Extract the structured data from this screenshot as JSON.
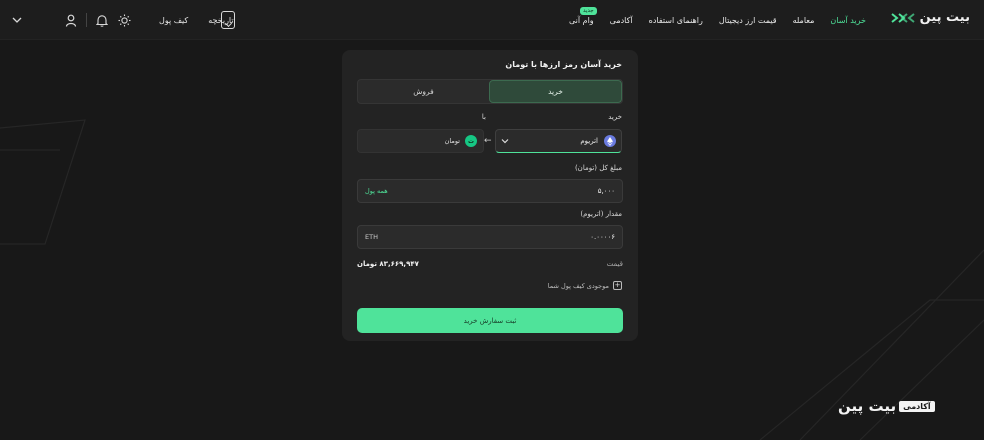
{
  "brand": {
    "name": "بیت پین"
  },
  "nav": {
    "items": [
      {
        "label": "خرید آسان",
        "active": true
      },
      {
        "label": "معامله",
        "active": false
      },
      {
        "label": "قیمت ارز دیجیتال",
        "active": false
      },
      {
        "label": "راهنمای استفاده",
        "active": false
      },
      {
        "label": "آکادمی",
        "active": false
      },
      {
        "label": "وام آنی",
        "active": false,
        "badge": "جدید"
      }
    ],
    "wallet_label": "کیف پول",
    "history_label": "تاریخچه"
  },
  "card": {
    "title": "خرید آسان رمز ارزها با تومان",
    "tabs": [
      {
        "label": "خرید",
        "active": true
      },
      {
        "label": "فروش",
        "active": false
      }
    ],
    "buy_label": "خرید",
    "with_label": "با",
    "currency_select": {
      "value": "اتریوم"
    },
    "pay_currency": {
      "label": "تومان",
      "icon_text": "ت"
    },
    "total_label": "مبلغ کل (تومان)",
    "total_value": "۵,۰۰۰",
    "all_balance_label": "همه پول",
    "amount_label": "مقدار (اتریوم)",
    "amount_value": "۰.۰۰۰۰۶",
    "amount_unit": "ETH",
    "price_label": "قیمت",
    "price_value": "۸۳,۶۶۹,۹۴۷ تومان",
    "balance_text": "موجودی کیف پول شما",
    "submit_label": "ثبت سفارش خرید"
  },
  "watermark": {
    "tag": "آکادمی",
    "text": "بیت پین"
  },
  "colors": {
    "accent": "#4fe39a",
    "background": "#181818",
    "card": "#232323"
  },
  "icons": [
    "logo-mark-icon",
    "mobile-app-icon",
    "sun-icon",
    "bell-icon",
    "user-icon",
    "chevron-down-icon",
    "ethereum-icon",
    "toman-icon",
    "arrow-left-icon",
    "plus-icon"
  ]
}
